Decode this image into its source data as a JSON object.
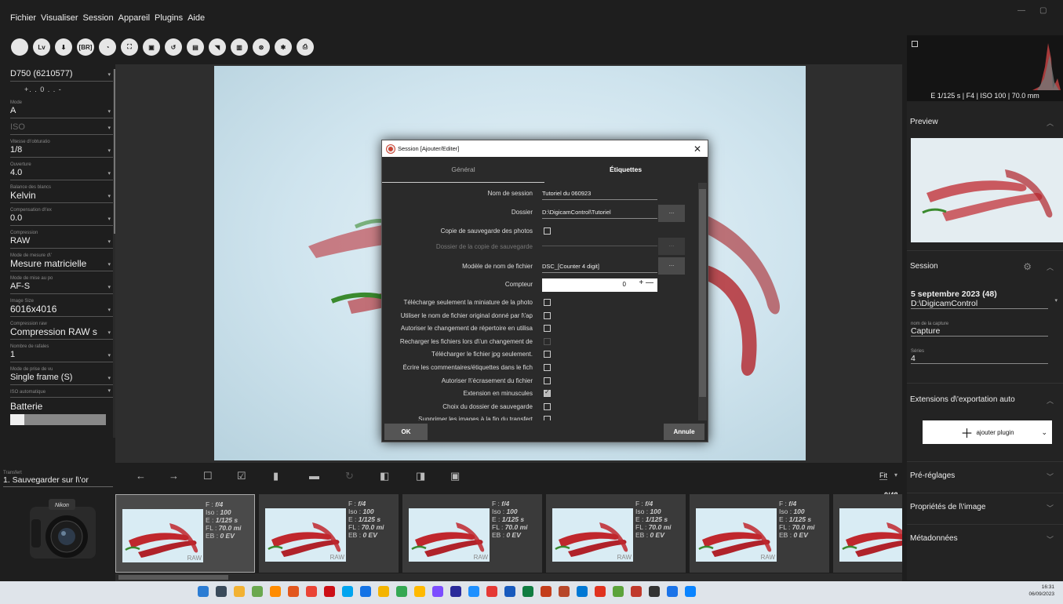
{
  "menu": [
    "Fichier",
    "Visualiser",
    "Session",
    "Appareil",
    "Plugins",
    "Aide"
  ],
  "window_controls": [
    "—",
    "▢"
  ],
  "toolbar_icons": [
    {
      "name": "aperture-icon",
      "glyph": ""
    },
    {
      "name": "liveview-icon",
      "glyph": "Lv"
    },
    {
      "name": "download-icon",
      "glyph": "⬇"
    },
    {
      "name": "bracketing-icon",
      "glyph": "[BR]"
    },
    {
      "name": "timelapse-icon",
      "glyph": "◔"
    },
    {
      "name": "focus-stack-icon",
      "glyph": "⛶"
    },
    {
      "name": "gallery-icon",
      "glyph": "▣"
    },
    {
      "name": "history-icon",
      "glyph": "↺"
    },
    {
      "name": "photo-icon",
      "glyph": "▤"
    },
    {
      "name": "webcast-icon",
      "glyph": "◥"
    },
    {
      "name": "barcode-icon",
      "glyph": "▥"
    },
    {
      "name": "network-icon",
      "glyph": "⊛"
    },
    {
      "name": "bluetooth-icon",
      "glyph": "✱"
    },
    {
      "name": "print-icon",
      "glyph": "⎙"
    }
  ],
  "left_panel": {
    "camera_name": "D750 (6210577)",
    "exposure_scale": "+. . 0 . . -",
    "fields": [
      {
        "caption": "Mode",
        "value": "A",
        "dim": false
      },
      {
        "caption": "",
        "value": "ISO",
        "dim": true
      },
      {
        "caption": "Vitesse d\\'obturatio",
        "value": "1/8",
        "dim": false
      },
      {
        "caption": "Ouverture",
        "value": "4.0",
        "dim": false
      },
      {
        "caption": "Balance des blancs",
        "value": "Kelvin",
        "dim": false
      },
      {
        "caption": "Compensation d\\'ex",
        "value": "0.0",
        "dim": false
      },
      {
        "caption": "Compression",
        "value": "RAW",
        "dim": false
      },
      {
        "caption": "Mode de mesure d\\'",
        "value": "Mesure matricielle",
        "dim": false
      },
      {
        "caption": "Mode de mise au po",
        "value": "AF-S",
        "dim": false
      },
      {
        "caption": "Image Size",
        "value": "6016x4016",
        "dim": false
      },
      {
        "caption": "Compression raw",
        "value": "Compression RAW s",
        "dim": false
      },
      {
        "caption": "Nombre de rafales",
        "value": "1",
        "dim": false
      },
      {
        "caption": "Mode de prise de vu",
        "value": "Single frame (S)",
        "dim": false
      },
      {
        "caption": "ISO automatique",
        "value": "",
        "dim": false
      }
    ],
    "battery_label": "Batterie",
    "battery_level": 0.15,
    "transfer_caption": "Transfert",
    "transfer_value": "1. Sauvegarder sur l\\'or",
    "camera_brand": "Nikon"
  },
  "dialog": {
    "title": "Session [Ajouter/Editer]",
    "close": "✕",
    "tabs": [
      "Général",
      "Étiquettes"
    ],
    "active_tab": 1,
    "fields": {
      "session_name_label": "Nom de session",
      "session_name_value": "Tutoriel du 060923",
      "folder_label": "Dossier",
      "folder_value": "D:\\DigicamControl\\Tutoriel",
      "backup_label": "Copie de sauvegarde des photos",
      "backup_folder_label": "Dossier de la copie de sauvegarde",
      "filename_template_label": "Modèle de nom de fichier",
      "filename_template_value": "DSC_[Counter 4 digit]",
      "counter_label": "Compteur",
      "counter_value": "0",
      "counter_controls": "+ —",
      "browse": "..."
    },
    "checkboxes": [
      {
        "label": "Télécharge seulement la miniature de la photo",
        "checked": false,
        "disabled": false
      },
      {
        "label": "Utiliser le nom de fichier original donné par l\\'ap",
        "checked": false,
        "disabled": false
      },
      {
        "label": "Autoriser le changement de répertoire en utilisa",
        "checked": false,
        "disabled": false
      },
      {
        "label": "Recharger les fichiers lors d\\'un changement de",
        "checked": false,
        "disabled": true
      },
      {
        "label": "Télécharger le fichier jpg seulement.",
        "checked": false,
        "disabled": false
      },
      {
        "label": "Écrire les commentaires/étiquettes dans le fich",
        "checked": false,
        "disabled": false
      },
      {
        "label": "Autoriser l\\'écrasement du fichier",
        "checked": false,
        "disabled": false
      },
      {
        "label": "Extension en minuscules",
        "checked": true,
        "disabled": false
      },
      {
        "label": "Choix du dossier de sauvegarde",
        "checked": false,
        "disabled": false
      },
      {
        "label": "Supprimer les images à la fin du transfert",
        "checked": false,
        "disabled": false
      }
    ],
    "ok": "OK",
    "cancel": "Annule"
  },
  "bottom_toolbar": {
    "icons": [
      "back-arrow-icon",
      "forward-arrow-icon",
      "select-none-icon",
      "select-all-icon",
      "delete-icon",
      "folder-icon",
      "rotate-icon",
      "compare-icon",
      "compare2-icon",
      "image-icon"
    ],
    "fit": "Fit",
    "count": "0/48"
  },
  "thumbnails": [
    {
      "f": "f/4",
      "iso": "100",
      "e": "1/125 s",
      "fl": "70.0 mi",
      "eb": "0 EV",
      "raw": "RAW",
      "selected": true
    },
    {
      "f": "f/4",
      "iso": "100",
      "e": "1/125 s",
      "fl": "70.0 mi",
      "eb": "0 EV",
      "raw": "RAW",
      "selected": false
    },
    {
      "f": "f/4",
      "iso": "100",
      "e": "1/125 s",
      "fl": "70.0 mi",
      "eb": "0 EV",
      "raw": "RAW",
      "selected": false
    },
    {
      "f": "f/4",
      "iso": "100",
      "e": "1/125 s",
      "fl": "70.0 mi",
      "eb": "0 EV",
      "raw": "RAW",
      "selected": false
    },
    {
      "f": "f/4",
      "iso": "100",
      "e": "1/125 s",
      "fl": "70.0 mi",
      "eb": "0 EV",
      "raw": "RAW",
      "selected": false
    },
    {
      "f": "",
      "iso": "",
      "e": "",
      "fl": "",
      "eb": "",
      "raw": "RA",
      "selected": false
    }
  ],
  "thumb_labels": {
    "f": "F : ",
    "iso": "Iso : ",
    "e": "E : ",
    "fl": "FL : ",
    "eb": "EB : "
  },
  "right_panel": {
    "exif_summary": "E 1/125 s | F4 | ISO 100 | 70.0 mm",
    "preview_title": "Preview",
    "session_title": "Session",
    "session_date": "5 septembre 2023",
    "session_count": "(48)",
    "session_path": "D:\\DigicamControl",
    "capture_caption": "nom de la capture",
    "capture_value": "Capture",
    "series_caption": "Séries",
    "series_value": "4",
    "export_title": "Extensions d\\'exportation auto",
    "add_plugin": "ajouter plugin",
    "presets_title": "Pré-réglages",
    "image_props_title": "Propriétés de l\\'image",
    "metadata_title": "Métadonnées"
  },
  "taskbar": {
    "time": "16:31",
    "date": "06/09/2023",
    "colors": [
      "#2b7cd3",
      "#3a4a5a",
      "#f2b233",
      "#6aa84f",
      "#ff8c00",
      "#e2571e",
      "#ea4335",
      "#cc0f16",
      "#00a4ef",
      "#1473e6",
      "#f4b400",
      "#34a853",
      "#ffb900",
      "#7c4dff",
      "#2a2a9a",
      "#1e90ff",
      "#e53935",
      "#185abd",
      "#107c41",
      "#c43e1c",
      "#b7472a",
      "#0078d4",
      "#e0321e",
      "#5ca33b",
      "#c0392b",
      "#333333",
      "#1a73e8",
      "#0a84ff"
    ]
  },
  "accent_colors": {
    "dialog_bg": "#2a2a2a",
    "panel_bg": "#232323",
    "pepper": "#c0272d"
  }
}
